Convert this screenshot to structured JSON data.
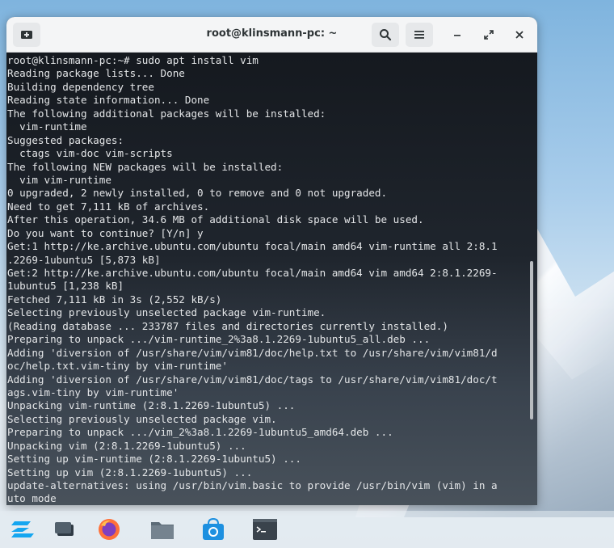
{
  "window": {
    "title": "root@klinsmann-pc: ~",
    "new_tab_icon": "new-tab-icon",
    "search_icon": "search-icon",
    "menu_icon": "hamburger-menu-icon"
  },
  "terminal": {
    "lines": [
      "root@klinsmann-pc:~# sudo apt install vim",
      "Reading package lists... Done",
      "Building dependency tree",
      "Reading state information... Done",
      "The following additional packages will be installed:",
      "  vim-runtime",
      "Suggested packages:",
      "  ctags vim-doc vim-scripts",
      "The following NEW packages will be installed:",
      "  vim vim-runtime",
      "0 upgraded, 2 newly installed, 0 to remove and 0 not upgraded.",
      "Need to get 7,111 kB of archives.",
      "After this operation, 34.6 MB of additional disk space will be used.",
      "Do you want to continue? [Y/n] y",
      "Get:1 http://ke.archive.ubuntu.com/ubuntu focal/main amd64 vim-runtime all 2:8.1",
      ".2269-1ubuntu5 [5,873 kB]",
      "Get:2 http://ke.archive.ubuntu.com/ubuntu focal/main amd64 vim amd64 2:8.1.2269-",
      "1ubuntu5 [1,238 kB]",
      "Fetched 7,111 kB in 3s (2,552 kB/s)",
      "Selecting previously unselected package vim-runtime.",
      "(Reading database ... 233787 files and directories currently installed.)",
      "Preparing to unpack .../vim-runtime_2%3a8.1.2269-1ubuntu5_all.deb ...",
      "Adding 'diversion of /usr/share/vim/vim81/doc/help.txt to /usr/share/vim/vim81/d",
      "oc/help.txt.vim-tiny by vim-runtime'",
      "Adding 'diversion of /usr/share/vim/vim81/doc/tags to /usr/share/vim/vim81/doc/t",
      "ags.vim-tiny by vim-runtime'",
      "Unpacking vim-runtime (2:8.1.2269-1ubuntu5) ...",
      "Selecting previously unselected package vim.",
      "Preparing to unpack .../vim_2%3a8.1.2269-1ubuntu5_amd64.deb ...",
      "Unpacking vim (2:8.1.2269-1ubuntu5) ...",
      "Setting up vim-runtime (2:8.1.2269-1ubuntu5) ...",
      "Setting up vim (2:8.1.2269-1ubuntu5) ...",
      "update-alternatives: using /usr/bin/vim.basic to provide /usr/bin/vim (vim) in a",
      "uto mode"
    ]
  },
  "taskbar": {
    "apps": [
      {
        "name": "zorin-menu-icon"
      },
      {
        "name": "show-desktop-icon"
      },
      {
        "name": "firefox-icon"
      },
      {
        "name": "files-icon"
      },
      {
        "name": "software-store-icon"
      },
      {
        "name": "terminal-app-icon"
      }
    ]
  }
}
